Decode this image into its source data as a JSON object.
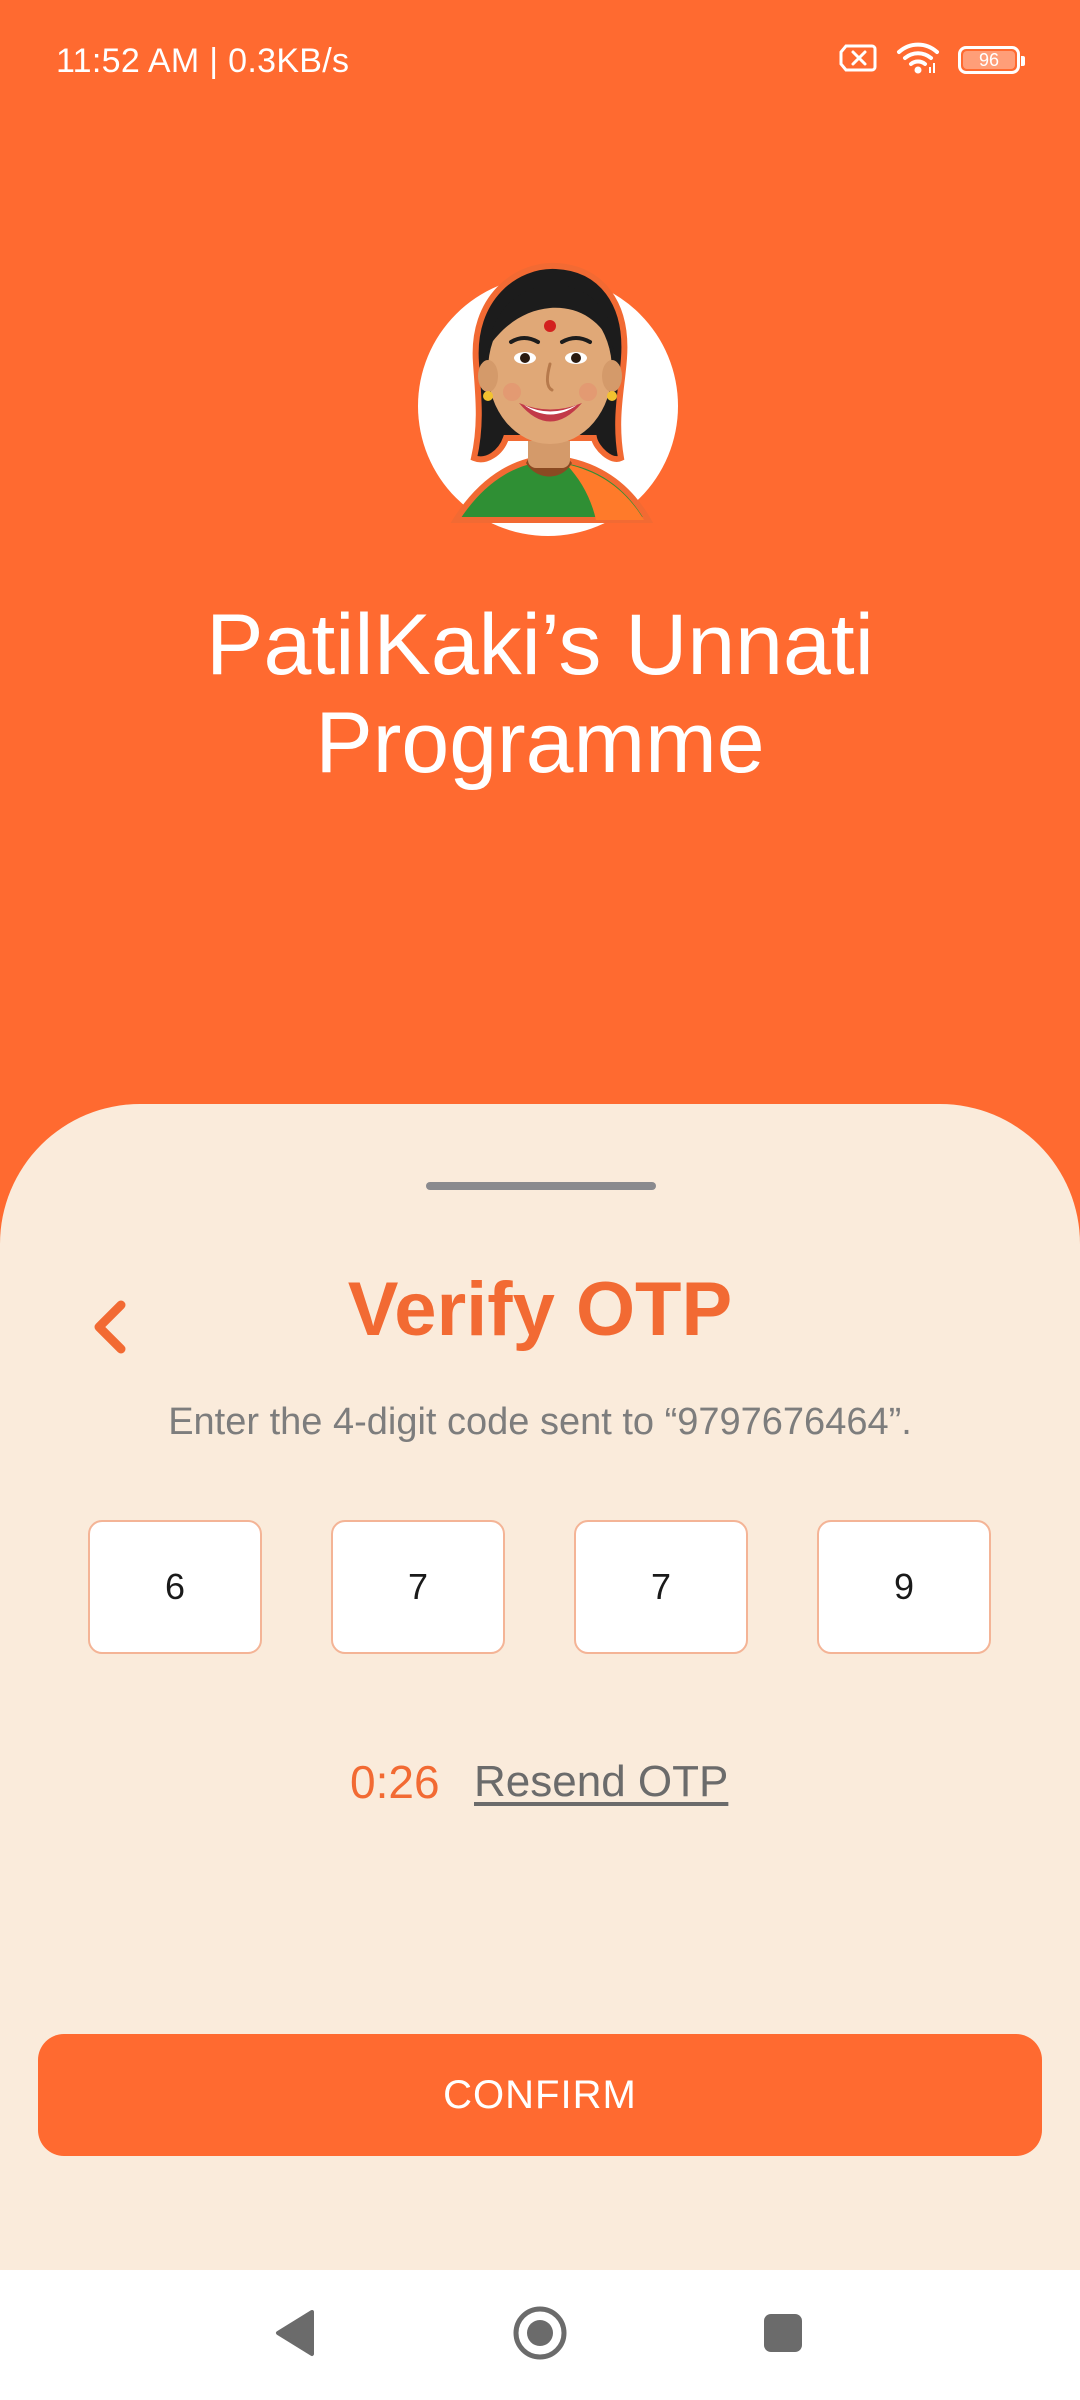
{
  "status_bar": {
    "time_speed": "11:52 AM | 0.3KB/s",
    "battery_level": "96",
    "icons": [
      "sim-error-icon",
      "wifi-icon",
      "battery-icon"
    ]
  },
  "header": {
    "title_line1": "PatilKaki’s Unnati",
    "title_line2": "Programme",
    "avatar_icon": "woman-avatar-illustration"
  },
  "otp_sheet": {
    "title": "Verify OTP",
    "instruction": "Enter the 4-digit code sent to “9797676464”.",
    "digits": [
      "6",
      "7",
      "7",
      "9"
    ],
    "timer": "0:26",
    "resend_label": "Resend OTP",
    "confirm_label": "CONFIRM",
    "back_icon": "chevron-left-icon"
  },
  "nav_bar": {
    "icons": [
      "nav-back-icon",
      "nav-home-icon",
      "nav-recents-icon"
    ]
  },
  "colors": {
    "brand_orange": "#ff6a30",
    "sheet_background": "#faebdb",
    "accent_text": "#f26a33"
  }
}
